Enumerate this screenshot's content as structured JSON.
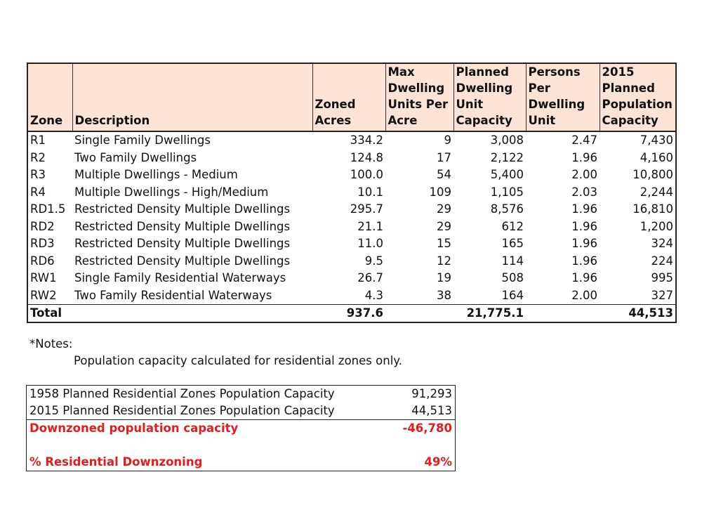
{
  "table": {
    "headers": [
      "Zone",
      "Description",
      "Zoned Acres",
      "Max Dwelling Units Per Acre",
      "Planned Dwelling Unit Capacity",
      "Persons Per Dwelling Unit",
      "2015 Planned Population Capacity"
    ],
    "rows": [
      {
        "zone": "R1",
        "description": "Single Family Dwellings",
        "acres": "334.2",
        "max_units": "9",
        "planned_units": "3,008",
        "persons": "2.47",
        "population": "7,430"
      },
      {
        "zone": "R2",
        "description": "Two Family Dwellings",
        "acres": "124.8",
        "max_units": "17",
        "planned_units": "2,122",
        "persons": "1.96",
        "population": "4,160"
      },
      {
        "zone": "R3",
        "description": "Multiple Dwellings - Medium",
        "acres": "100.0",
        "max_units": "54",
        "planned_units": "5,400",
        "persons": "2.00",
        "population": "10,800"
      },
      {
        "zone": "R4",
        "description": "Multiple Dwellings - High/Medium",
        "acres": "10.1",
        "max_units": "109",
        "planned_units": "1,105",
        "persons": "2.03",
        "population": "2,244"
      },
      {
        "zone": "RD1.5",
        "description": "Restricted Density Multiple Dwellings",
        "acres": "295.7",
        "max_units": "29",
        "planned_units": "8,576",
        "persons": "1.96",
        "population": "16,810"
      },
      {
        "zone": "RD2",
        "description": "Restricted Density Multiple Dwellings",
        "acres": "21.1",
        "max_units": "29",
        "planned_units": "612",
        "persons": "1.96",
        "population": "1,200"
      },
      {
        "zone": "RD3",
        "description": "Restricted Density Multiple Dwellings",
        "acres": "11.0",
        "max_units": "15",
        "planned_units": "165",
        "persons": "1.96",
        "population": "324"
      },
      {
        "zone": "RD6",
        "description": "Restricted Density Multiple Dwellings",
        "acres": "9.5",
        "max_units": "12",
        "planned_units": "114",
        "persons": "1.96",
        "population": "224"
      },
      {
        "zone": "RW1",
        "description": "Single Family Residential Waterways",
        "acres": "26.7",
        "max_units": "19",
        "planned_units": "508",
        "persons": "1.96",
        "population": "995"
      },
      {
        "zone": "RW2",
        "description": "Two Family Residential Waterways",
        "acres": "4.3",
        "max_units": "38",
        "planned_units": "164",
        "persons": "2.00",
        "population": "327"
      }
    ],
    "total": {
      "label": "Total",
      "acres": "937.6",
      "planned_units": "21,775.1",
      "population": "44,513"
    }
  },
  "notes": {
    "title": "*Notes:",
    "text": "Population capacity calculated for residential zones only."
  },
  "summary": {
    "rows": [
      {
        "label": "1958 Planned Residential Zones Population Capacity",
        "value": "91,293"
      },
      {
        "label": "2015 Planned Residential Zones Population Capacity",
        "value": "44,513"
      }
    ],
    "downzoned": {
      "label": "Downzoned population capacity",
      "value": "-46,780"
    },
    "percent": {
      "label": "% Residential Downzoning",
      "value": "49%"
    },
    "accent_color": "#e31d1d"
  }
}
